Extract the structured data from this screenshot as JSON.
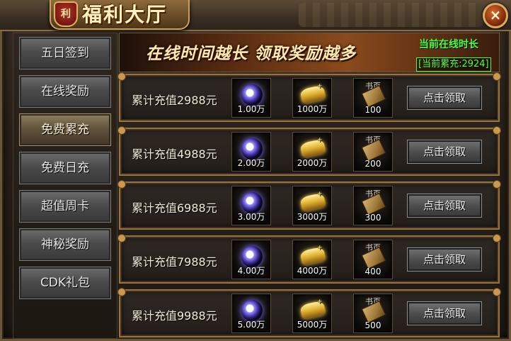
{
  "window": {
    "title": "福利大厅",
    "emblem": "利",
    "close_label": "×"
  },
  "sidebar": {
    "items": [
      {
        "label": "五日签到",
        "active": false
      },
      {
        "label": "在线奖励",
        "active": false
      },
      {
        "label": "免费累充",
        "active": true
      },
      {
        "label": "免费日充",
        "active": false
      },
      {
        "label": "超值周卡",
        "active": false
      },
      {
        "label": "神秘奖励",
        "active": false
      },
      {
        "label": "CDK礼包",
        "active": false
      }
    ]
  },
  "banner": {
    "slogan": "在线时间越长 领取奖励越多",
    "online_time_label": "当前在线时长",
    "current_total": "[当前累充:2924]"
  },
  "rewards": [
    {
      "label": "累计充值2988元",
      "orb_qty": "1.00万",
      "ingot_qty": "1000万",
      "book_tag": "书页",
      "book_qty": "100",
      "button": "点击领取"
    },
    {
      "label": "累计充值4988元",
      "orb_qty": "2.00万",
      "ingot_qty": "2000万",
      "book_tag": "书页",
      "book_qty": "200",
      "button": "点击领取"
    },
    {
      "label": "累计充值6988元",
      "orb_qty": "3.00万",
      "ingot_qty": "3000万",
      "book_tag": "书页",
      "book_qty": "300",
      "button": "点击领取"
    },
    {
      "label": "累计充值7988元",
      "orb_qty": "4.00万",
      "ingot_qty": "4000万",
      "book_tag": "书页",
      "book_qty": "400",
      "button": "点击领取"
    },
    {
      "label": "累计充值9988元",
      "orb_qty": "5.00万",
      "ingot_qty": "5000万",
      "book_tag": "书页",
      "book_qty": "500",
      "button": "点击领取"
    }
  ],
  "icons": {
    "orb": "purple-orb-icon",
    "ingot": "gold-ingot-icon",
    "book": "book-page-icon",
    "close": "close-icon"
  },
  "colors": {
    "accent_green": "#4cff3c",
    "gold_border": "#9a7440",
    "title": "#fff2c4"
  }
}
